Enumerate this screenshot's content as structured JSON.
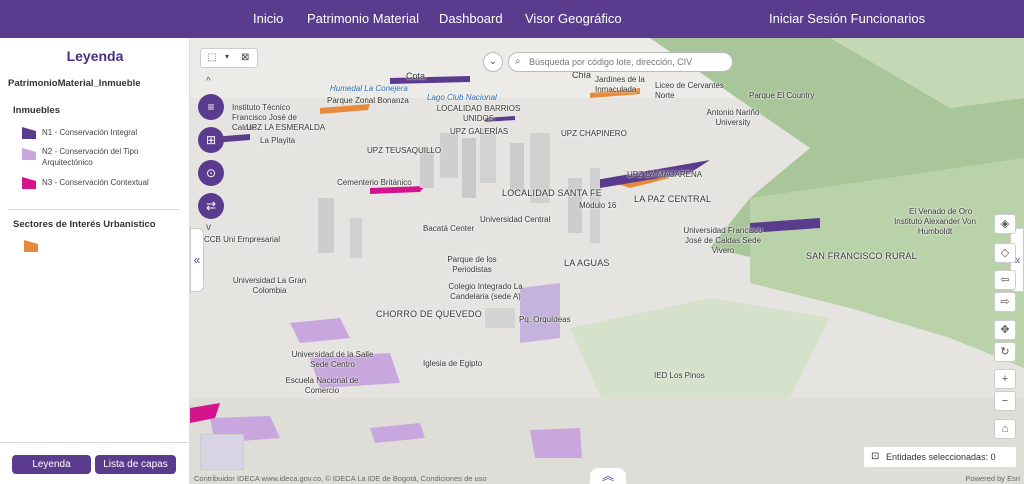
{
  "nav": {
    "links": [
      "Inicio",
      "Patrimonio Material",
      "Dashboard",
      "Visor Geográfico"
    ],
    "login": "Iniciar Sesión Funcionarios"
  },
  "sidebar": {
    "title": "Leyenda",
    "layer_name": "PatrimonioMaterial_Inmueble",
    "group1": "Inmuebles",
    "items": [
      {
        "label": "N1 - Conservación Integral",
        "color": "#5b3b8e"
      },
      {
        "label": "N2 - Conservación del Tipo Arquitectónico",
        "color": "#c7a7dd"
      },
      {
        "label": "N3 - Conservación Contextual",
        "color": "#d4148c"
      }
    ],
    "group2": "Sectores de Interés Urbanístico",
    "sector_color": "#e88a3c",
    "btn_legend": "Leyenda",
    "btn_layers": "Lista de capas"
  },
  "map": {
    "search_placeholder": "Búsqueda por código lote, dirección, CIV",
    "entidades": "Entidades seleccionadas: 0",
    "attribution": "Contribuidor IDECA www.ideca.gov.co, © IDECA La IDE de Bogotá, Condiciones de uso",
    "esri": "Powered by Esri",
    "labels": {
      "cota": "Cota",
      "chia": "Chía",
      "jardines": "Jardines de la Inmaculada",
      "liceo": "Liceo de Cervantes Norte",
      "parque_country": "Parque El Country",
      "humedal": "Humedal La Conejera",
      "parque_bonanza": "Parque Zonal Bonanza",
      "lago_club": "Lago Club Nacional",
      "barrios_unidos": "LOCALIDAD BARRIOS UNIDOS",
      "instituto": "Instituto Técnico Francisco José de Caldas",
      "upz_esmeralda": "UPZ LA ESMERALDA",
      "playita": "La Playita",
      "upz_galerias": "UPZ GALERÍAS",
      "upz_chapinero": "UPZ CHAPINERO",
      "antonio": "Antonio Nariño University",
      "upz_teusaquillo": "UPZ TEUSAQUILLO",
      "upz_macarena": "UPZ LA MACARENA",
      "cementerio": "Cementerio Británico",
      "localidad_santa_fe": "LOCALIDAD SANTA FE",
      "paz_central": "LA PAZ CENTRAL",
      "modulo": "Módulo 16",
      "universidad_central": "Universidad Central",
      "venado": "El Venado de Oro",
      "instituto_humboldt": "Instituto Alexander Von Humboldt",
      "bacata": "Bacatá Center",
      "sena": "CCB Uni Empresarial",
      "francisco": "Universidad Francisco José de Caldas Sede Vivero",
      "san_francisco": "SAN FRANCISCO RURAL",
      "periodistas": "Parque de los Periodistas",
      "aguas": "LA AGUAS",
      "gran_colombia": "Universidad La Gran Colombia",
      "colegio": "Colegio Integrado La Candelaria (sede A)",
      "chorro": "CHORRO DE QUEVEDO",
      "orquideas": "Pq. Orquídeas",
      "salle": "Universidad de la Salle Sede Centro",
      "egipto": "Iglesia de Egipto",
      "escuela": "Escuela Nacional de Comercio",
      "ied": "IED Los Pinos"
    }
  }
}
